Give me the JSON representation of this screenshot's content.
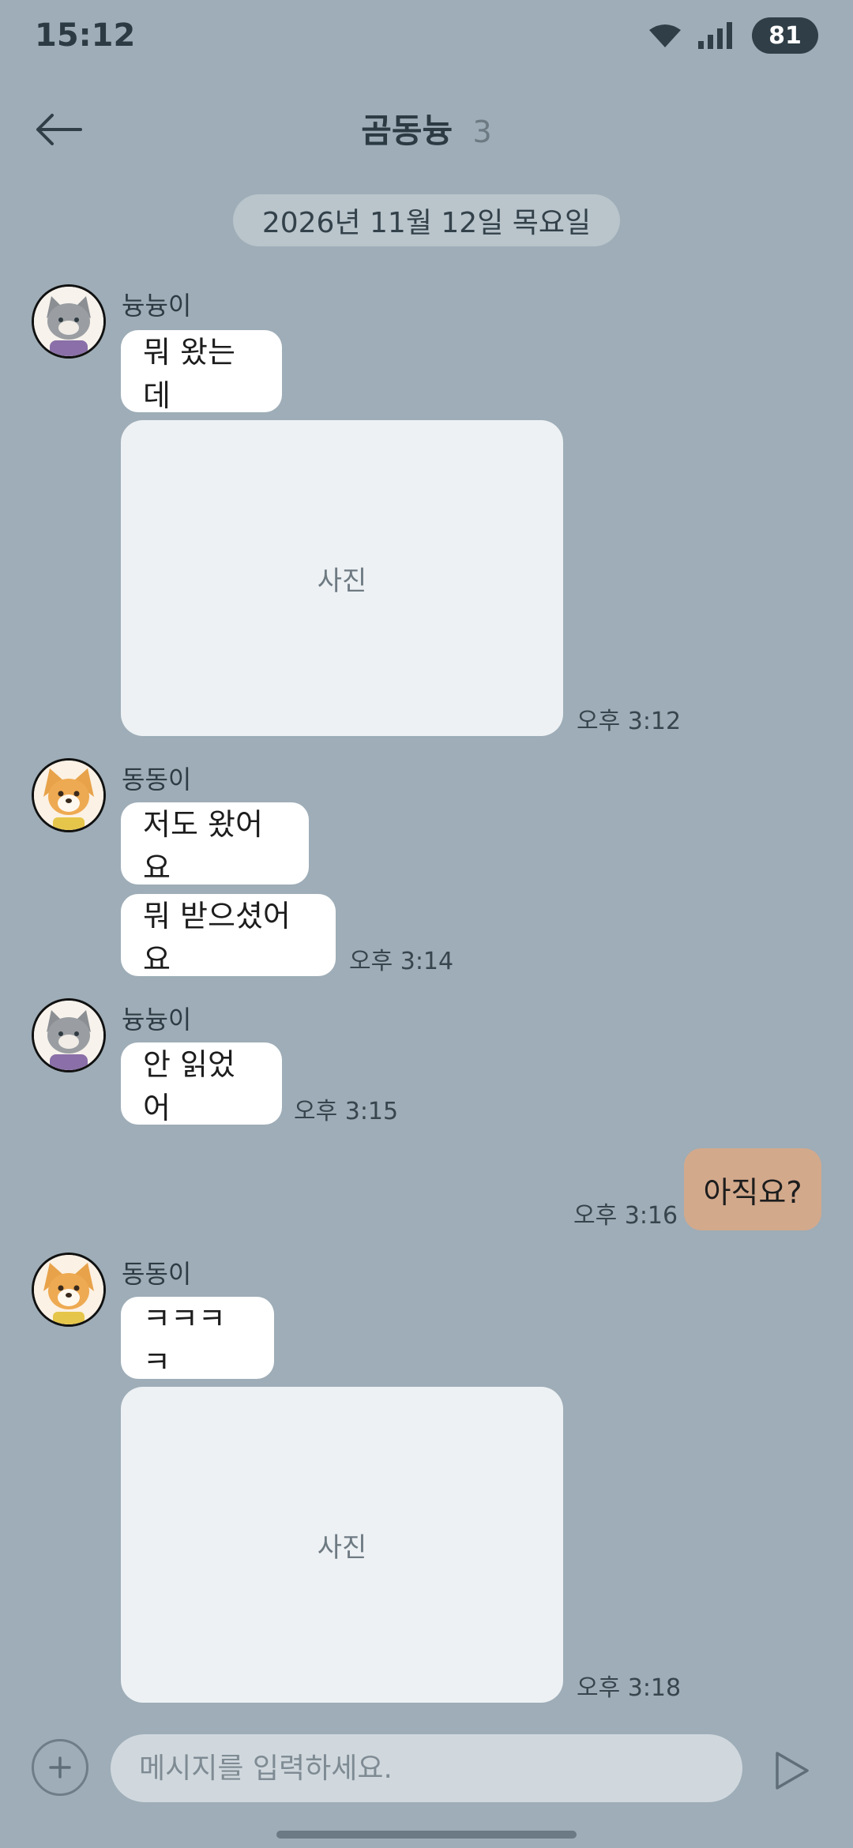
{
  "status_bar": {
    "time": "15:12",
    "battery": "81"
  },
  "header": {
    "title": "곰동늉",
    "member_count": "3"
  },
  "date_divider": "2026년 11월 12일 목요일",
  "messages": [
    {
      "sender": "늉늉이",
      "text": "뭐 왔는데"
    },
    {
      "photo_label": "사진",
      "time": "오후 3:12"
    },
    {
      "sender": "동동이",
      "text": "저도 왔어요"
    },
    {
      "text": "뭐 받으셨어요",
      "time": "오후 3:14"
    },
    {
      "sender": "늉늉이",
      "text": "안 읽었어",
      "time": "오후 3:15"
    },
    {
      "text": "아직요?",
      "time": "오후 3:16"
    },
    {
      "sender": "동동이",
      "text": "ㅋㅋㅋㅋ"
    },
    {
      "photo_label": "사진",
      "time": "오후 3:18"
    }
  ],
  "composer": {
    "placeholder": "메시지를 입력하세요."
  },
  "colors": {
    "background": "#9eadb7",
    "my_bubble": "#d3a98c",
    "other_bubble": "#ffffff"
  }
}
